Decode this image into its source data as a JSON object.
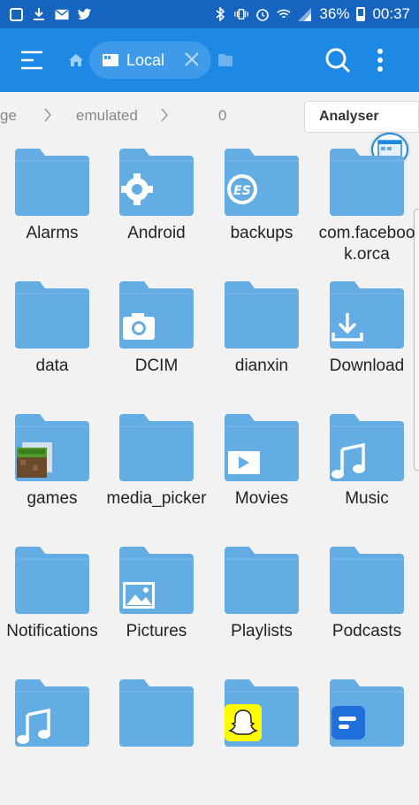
{
  "status_bar": {
    "battery": "36%",
    "time": "00:37",
    "left_icons": [
      "notification-icon",
      "download-icon",
      "email-icon",
      "twitter-icon"
    ],
    "right_icons": [
      "bluetooth-icon",
      "vibrate-icon",
      "alarm-icon",
      "wifi-icon",
      "signal-icon",
      "battery-icon"
    ]
  },
  "app_bar": {
    "tab_label": "Local",
    "colors": {
      "bar": "#1e88e5",
      "status": "#1565c0",
      "tab": "#3f9bea"
    }
  },
  "breadcrumb": {
    "items": [
      "ge",
      "emulated",
      "0"
    ],
    "analyse_label": "Analyser"
  },
  "folders": [
    {
      "label": "Alarms",
      "badge": ""
    },
    {
      "label": "Android",
      "badge": "gear"
    },
    {
      "label": "backups",
      "badge": "es"
    },
    {
      "label": "com.facebook.orca",
      "badge": ""
    },
    {
      "label": "data",
      "badge": ""
    },
    {
      "label": "DCIM",
      "badge": "camera"
    },
    {
      "label": "dianxin",
      "badge": ""
    },
    {
      "label": "Download",
      "badge": "download"
    },
    {
      "label": "games",
      "badge": "minecraft"
    },
    {
      "label": "media_picker",
      "badge": ""
    },
    {
      "label": "Movies",
      "badge": "video"
    },
    {
      "label": "Music",
      "badge": "music"
    },
    {
      "label": "Notifications",
      "badge": ""
    },
    {
      "label": "Pictures",
      "badge": "picture"
    },
    {
      "label": "Playlists",
      "badge": ""
    },
    {
      "label": "Podcasts",
      "badge": ""
    },
    {
      "label": "",
      "badge": "music"
    },
    {
      "label": "",
      "badge": ""
    },
    {
      "label": "",
      "badge": "snapchat"
    },
    {
      "label": "",
      "badge": "flow"
    }
  ],
  "folder_color": "#64ace4"
}
